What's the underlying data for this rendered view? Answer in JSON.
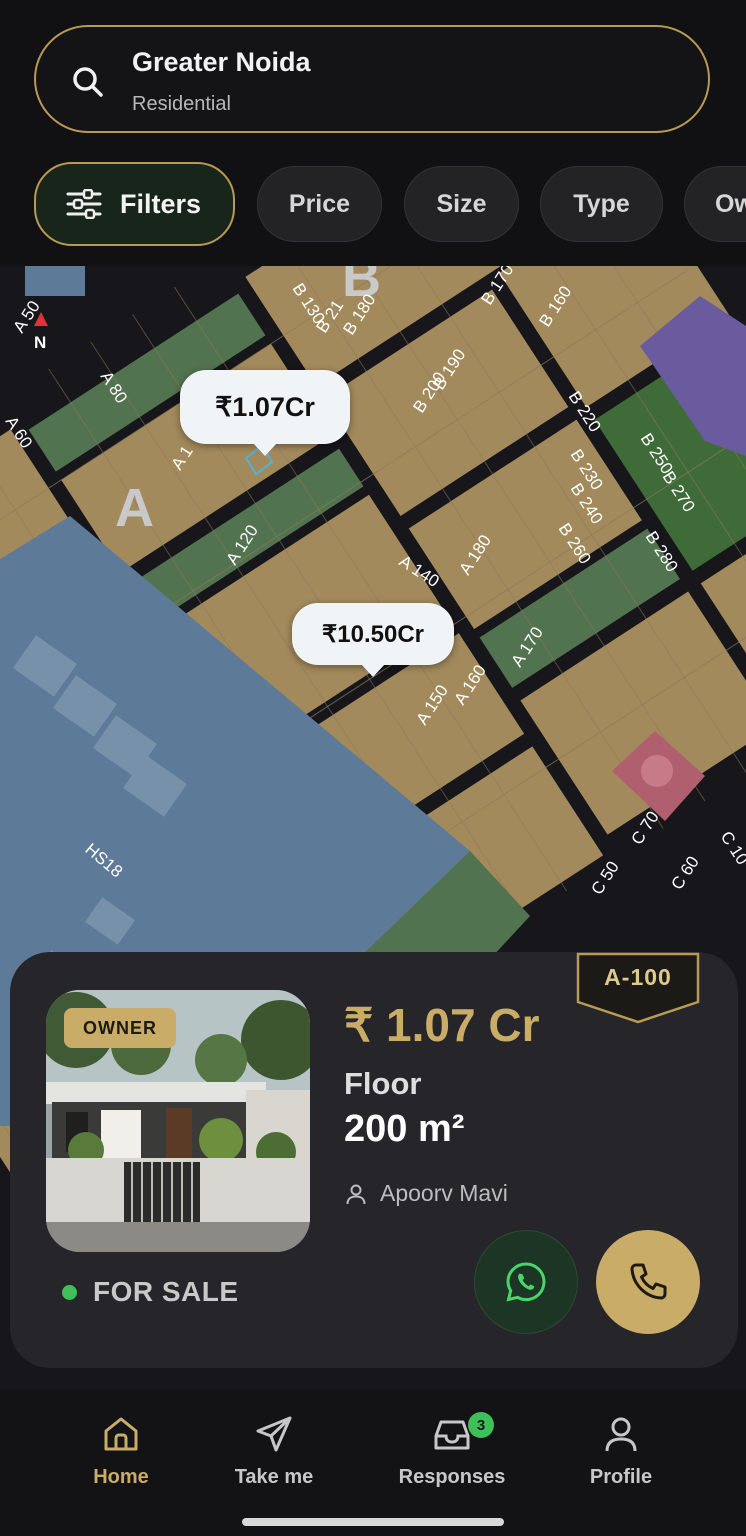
{
  "search": {
    "title": "Greater Noida",
    "subtitle": "Residential"
  },
  "filters": [
    "Filters",
    "Price",
    "Size",
    "Type",
    "Ow"
  ],
  "map": {
    "compass_label": "N",
    "block_letters": [
      "A",
      "B"
    ],
    "plot_labels": [
      "A 50",
      "A 60",
      "A 80",
      "A 1",
      "A 120",
      "A 140",
      "A 150",
      "A 160",
      "A 170",
      "A 180",
      "B 130",
      "B 180",
      "B 21",
      "B 200",
      "B 190",
      "B 170",
      "B 160",
      "B 220",
      "B 230",
      "B 240",
      "B 250",
      "B 260",
      "B 270",
      "B 280",
      "C 50",
      "C 60",
      "C 70",
      "C 10",
      "HS18"
    ],
    "price_markers": [
      "₹1.07Cr",
      "₹10.50Cr"
    ]
  },
  "listing": {
    "badge": "OWNER",
    "plot_id": "A-100",
    "price": "₹ 1.07 Cr",
    "type": "Floor",
    "size": "200 m²",
    "owner": "Apoorv Mavi",
    "status": "FOR SALE"
  },
  "nav": {
    "items": [
      {
        "label": "Home",
        "icon": "home-icon",
        "active": true
      },
      {
        "label": "Take me",
        "icon": "navigate-icon"
      },
      {
        "label": "Responses",
        "icon": "inbox-icon",
        "badge": "3"
      },
      {
        "label": "Profile",
        "icon": "person-icon"
      }
    ]
  },
  "colors": {
    "accent": "#c9ac68",
    "plot": "#a38a5c",
    "park": "#52734f",
    "water": "#5e7a99",
    "road": "#0f0f12"
  }
}
